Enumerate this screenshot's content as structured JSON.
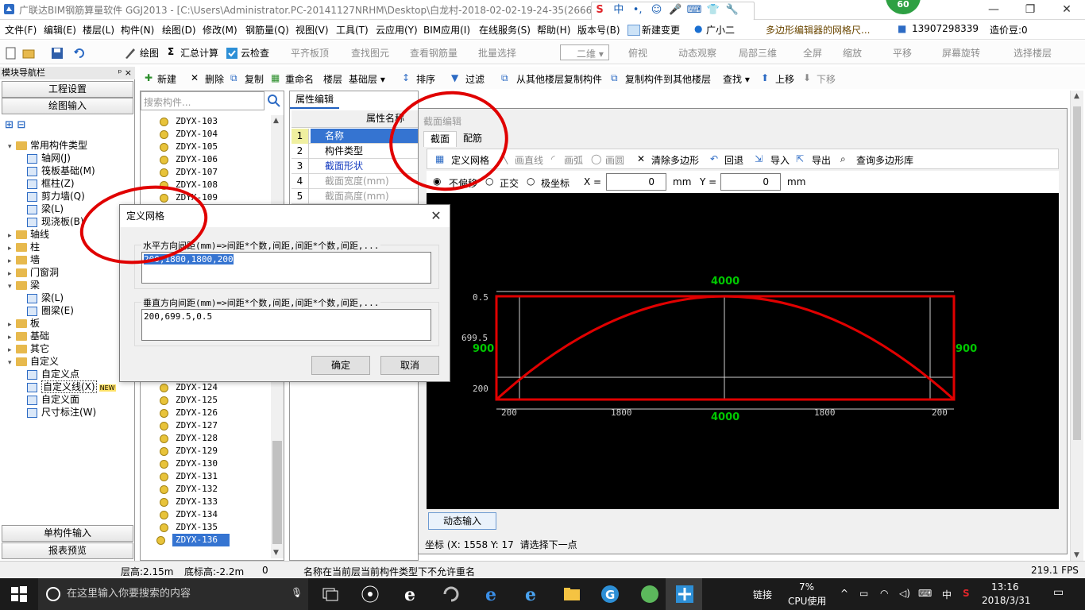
{
  "window": {
    "title": "广联达BIM钢筋算量软件 GGJ2013 - [C:\\Users\\Administrator.PC-20141127NRHM\\Desktop\\白龙村-2018-02-02-19-24-35(2666版",
    "badge": "60",
    "ime": [
      "S",
      "中",
      "•,",
      "☺",
      "🎤",
      "⌨",
      "👕",
      "🔧"
    ]
  },
  "menu": {
    "items": [
      "文件(F)",
      "编辑(E)",
      "楼层(L)",
      "构件(N)",
      "绘图(D)",
      "修改(M)",
      "钢筋量(Q)",
      "视图(V)",
      "工具(T)",
      "云应用(Y)",
      "BIM应用(I)",
      "在线服务(S)",
      "帮助(H)",
      "版本号(B)",
      "新建变更",
      "广小二",
      "多边形编辑器的网格尺...",
      "13907298339",
      "造价豆:0"
    ]
  },
  "toolbar1": {
    "draw": "绘图",
    "sum": "汇总计算",
    "cloudcheck": "云检查",
    "flat_slab": "平齐板顶",
    "find_elem": "查找图元",
    "view_rebar": "查看钢筋量",
    "batch_select": "批量选择",
    "view_mode": "二维",
    "top_view": "俯视",
    "dynamic_view": "动态观察",
    "local_3d": "局部三维",
    "fullscreen": "全屏",
    "zoom": "缩放",
    "pan": "平移",
    "rotate": "屏幕旋转",
    "select_floor": "选择楼层"
  },
  "toolbar2": {
    "new": "新建",
    "delete": "删除",
    "copy": "复制",
    "rename": "重命名",
    "floor_label": "楼层",
    "floor_value": "基础层",
    "sort": "排序",
    "filter": "过滤",
    "copy_from": "从其他楼层复制构件",
    "copy_to": "复制构件到其他楼层",
    "find": "查找",
    "up": "上移",
    "down": "下移"
  },
  "leftnav": {
    "header": "模块导航栏",
    "pin": "ᵖ ×",
    "project_settings": "工程设置",
    "drawing_input": "绘图输入",
    "single_input": "单构件输入",
    "report_preview": "报表预览",
    "tree": [
      {
        "label": "常用构件类型",
        "level": 0,
        "open": true
      },
      {
        "label": "轴网(J)",
        "level": 1
      },
      {
        "label": "筏板基础(M)",
        "level": 1
      },
      {
        "label": "框柱(Z)",
        "level": 1
      },
      {
        "label": "剪力墙(Q)",
        "level": 1
      },
      {
        "label": "梁(L)",
        "level": 1
      },
      {
        "label": "现浇板(B)",
        "level": 1
      },
      {
        "label": "轴线",
        "level": 0
      },
      {
        "label": "柱",
        "level": 0
      },
      {
        "label": "墙",
        "level": 0
      },
      {
        "label": "门窗洞",
        "level": 0
      },
      {
        "label": "梁",
        "level": 0,
        "open": true
      },
      {
        "label": "梁(L)",
        "level": 1
      },
      {
        "label": "圈梁(E)",
        "level": 1
      },
      {
        "label": "板",
        "level": 0
      },
      {
        "label": "基础",
        "level": 0
      },
      {
        "label": "其它",
        "level": 0
      },
      {
        "label": "自定义",
        "level": 0,
        "open": true
      },
      {
        "label": "自定义点",
        "level": 1
      },
      {
        "label": "自定义线(X)",
        "level": 1,
        "selected": true
      },
      {
        "label": "自定义面",
        "level": 1
      },
      {
        "label": "尺寸标注(W)",
        "level": 1
      }
    ],
    "new_tag": "NEW"
  },
  "components": {
    "search_placeholder": "搜索构件...",
    "top": [
      "ZDYX-103",
      "ZDYX-104",
      "ZDYX-105",
      "ZDYX-106",
      "ZDYX-107",
      "ZDYX-108",
      "ZDYX-109"
    ],
    "bottom": [
      "ZDYX-124",
      "ZDYX-125",
      "ZDYX-126",
      "ZDYX-127",
      "ZDYX-128",
      "ZDYX-129",
      "ZDYX-130",
      "ZDYX-131",
      "ZDYX-132",
      "ZDYX-133",
      "ZDYX-134",
      "ZDYX-135",
      "ZDYX-136"
    ]
  },
  "attributes": {
    "tab": "属性编辑",
    "header": "属性名称",
    "rows": [
      {
        "num": "1",
        "name": "名称"
      },
      {
        "num": "2",
        "name": "构件类型"
      },
      {
        "num": "3",
        "name": "截面形状"
      },
      {
        "num": "4",
        "name": "截面宽度(mm)"
      },
      {
        "num": "5",
        "name": "截面高度(mm)"
      }
    ]
  },
  "section_editor": {
    "caption": "截面编辑",
    "tabs": [
      "截面",
      "配筋"
    ],
    "tools": {
      "define_grid": "定义网格",
      "line": "画直线",
      "arc": "画弧",
      "circle": "画圆",
      "clear_polygon": "清除多边形",
      "undo": "回退",
      "import": "导入",
      "export": "导出",
      "query_lib": "查询多边形库"
    },
    "offset": {
      "none": "不偏移",
      "ortho": "正交",
      "polar": "极坐标",
      "x_label": "X =",
      "x_value": "0",
      "y_label": "Y =",
      "y_value": "0",
      "unit": "mm"
    },
    "dyn_input": "动态输入",
    "coord_label": "坐标 (X: 1558 Y: 17",
    "prompt": "请选择下一点",
    "drawing": {
      "top_dim": "4000",
      "bottom_dim": "4000",
      "left_dim": "900",
      "right_dim": "900",
      "v_labels": [
        "0.5",
        "699.5",
        "200"
      ],
      "h_labels": [
        "200",
        "1800",
        "1800",
        "200"
      ],
      "colors": {
        "outline": "#e00000",
        "dim": "#00c800",
        "grid": "#d0d0d0"
      }
    }
  },
  "dialog": {
    "title": "定义网格",
    "h_label": "水平方向间距(mm)=>间距*个数,间距,间距*个数,间距,...",
    "h_value": "200,1800,1800,200",
    "v_label": "垂直方向间距(mm)=>间距*个数,间距,间距*个数,间距,...",
    "v_value": "200,699.5,0.5",
    "ok": "确定",
    "cancel": "取消"
  },
  "status": {
    "floor_height": "层高:2.15m",
    "bottom_height": "底标高:-2.2m",
    "zero": "0",
    "message": "名称在当前层当前构件类型下不允许重名",
    "fps": "219.1 FPS"
  },
  "taskbar": {
    "search_placeholder": "在这里输入你要搜索的内容",
    "link": "链接",
    "cpu": "7%",
    "cpu_label": "CPU使用",
    "lang": "中",
    "time": "13:16",
    "date": "2018/3/31"
  }
}
